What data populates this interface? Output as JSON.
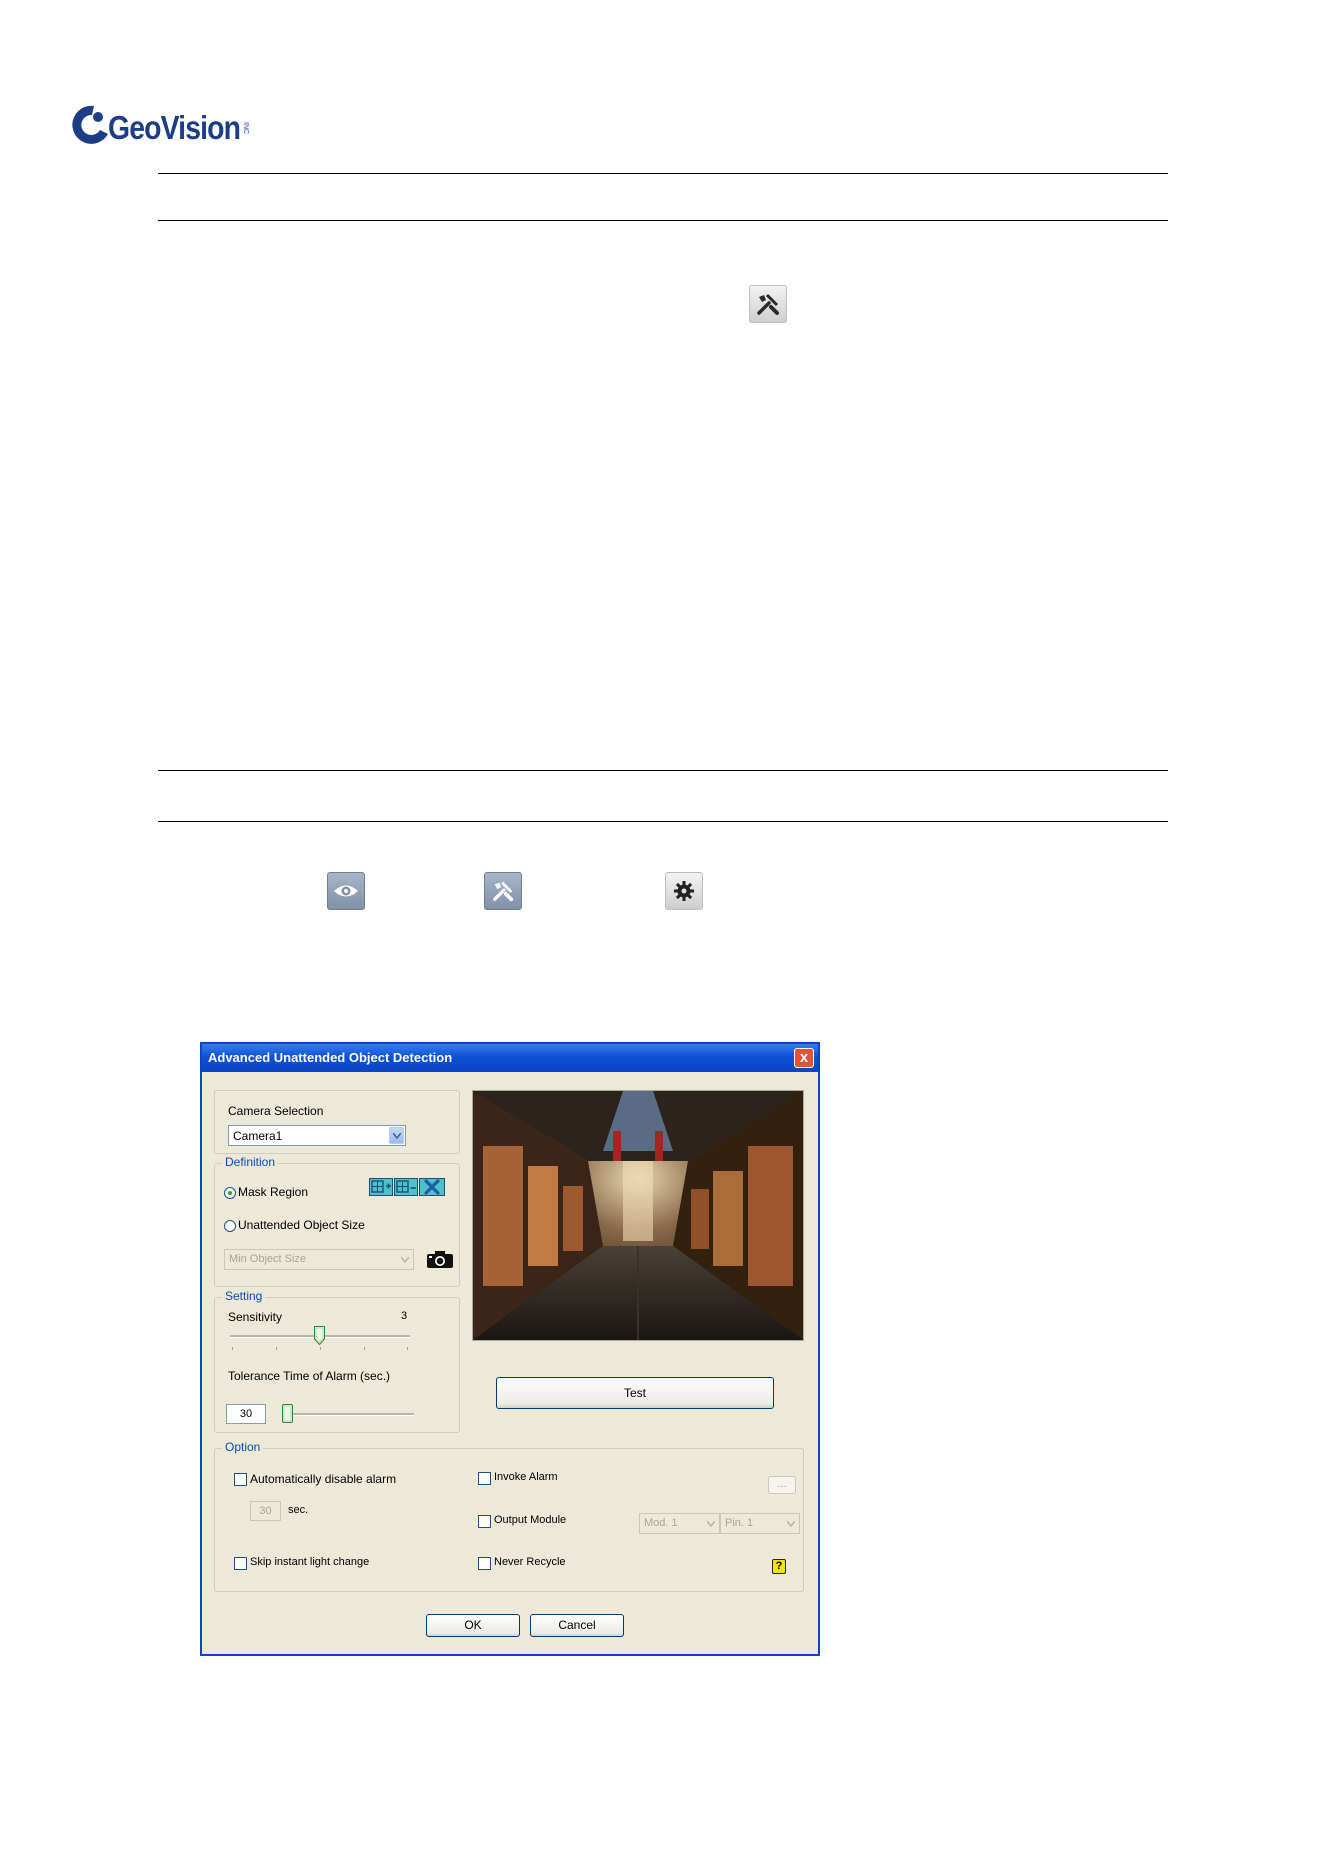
{
  "logo": {
    "name": "GeoVision",
    "small": "INC"
  },
  "dialog": {
    "title": "Advanced Unattended Object Detection",
    "camera_group_label": "Camera Selection",
    "camera_value": "Camera1",
    "definition_label": "Definition",
    "mask_region_label": "Mask Region",
    "unattended_size_label": "Unattended Object Size",
    "min_object_size": "Min Object Size",
    "setting_label": "Setting",
    "sensitivity_label": "Sensitivity",
    "sensitivity_value": "3",
    "tolerance_label": "Tolerance Time of Alarm (sec.)",
    "tolerance_value": "30",
    "test_label": "Test",
    "option_label": "Option",
    "auto_disable_label": "Automatically disable alarm",
    "auto_disable_value": "30",
    "sec_label": "sec.",
    "skip_light_label": "Skip instant light change",
    "invoke_alarm_label": "Invoke Alarm",
    "invoke_more_label": "...",
    "output_module_label": "Output Module",
    "module_value": "Mod. 1",
    "pin_value": "Pin. 1",
    "never_recycle_label": "Never Recycle",
    "help_label": "?",
    "ok_label": "OK",
    "cancel_label": "Cancel",
    "close_label": "x"
  },
  "levels": {
    "sensitivity_fraction": 0.5,
    "tolerance_fraction": 0.0
  },
  "colors": {
    "title_bar": "#0a45c8",
    "dialog_bg": "#ece9d8",
    "group_label": "#0a4bb4",
    "logo": "#1d3e86"
  },
  "icons": [
    "tools-icon",
    "eye-icon",
    "tools-icon",
    "gear-icon",
    "add-mask-icon",
    "remove-mask-icon",
    "clear-mask-icon",
    "camera-icon",
    "help-icon"
  ]
}
